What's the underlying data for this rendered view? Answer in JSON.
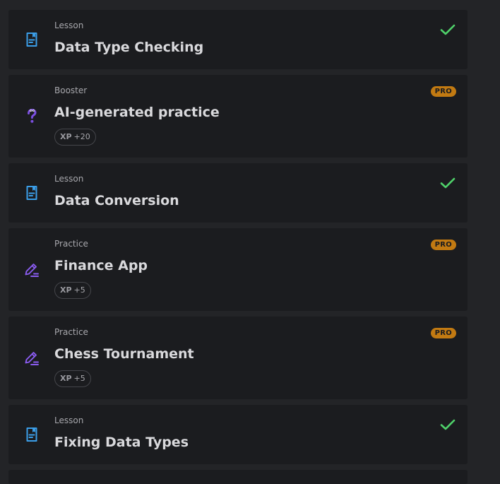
{
  "colors": {
    "page_background": "#232427",
    "card_background": "#1b1c1f",
    "lesson_icon": "#3b9ee8",
    "practice_icon": "#8a5cf0",
    "booster_icon": "#7b4fe0",
    "check": "#4fd16a",
    "pro_badge": "#c27a12"
  },
  "items": [
    {
      "type": "Lesson",
      "title": "Data Type Checking",
      "icon": "lesson-doc-icon",
      "status": "completed"
    },
    {
      "type": "Booster",
      "title": "AI-generated practice",
      "icon": "booster-question-icon",
      "badge": "PRO",
      "xp_label": "XP",
      "xp_value": "+20"
    },
    {
      "type": "Lesson",
      "title": "Data Conversion",
      "icon": "lesson-doc-icon",
      "status": "completed"
    },
    {
      "type": "Practice",
      "title": "Finance App",
      "icon": "practice-pencil-icon",
      "badge": "PRO",
      "xp_label": "XP",
      "xp_value": "+5"
    },
    {
      "type": "Practice",
      "title": "Chess Tournament",
      "icon": "practice-pencil-icon",
      "badge": "PRO",
      "xp_label": "XP",
      "xp_value": "+5"
    },
    {
      "type": "Lesson",
      "title": "Fixing Data Types",
      "icon": "lesson-doc-icon",
      "status": "completed"
    }
  ]
}
